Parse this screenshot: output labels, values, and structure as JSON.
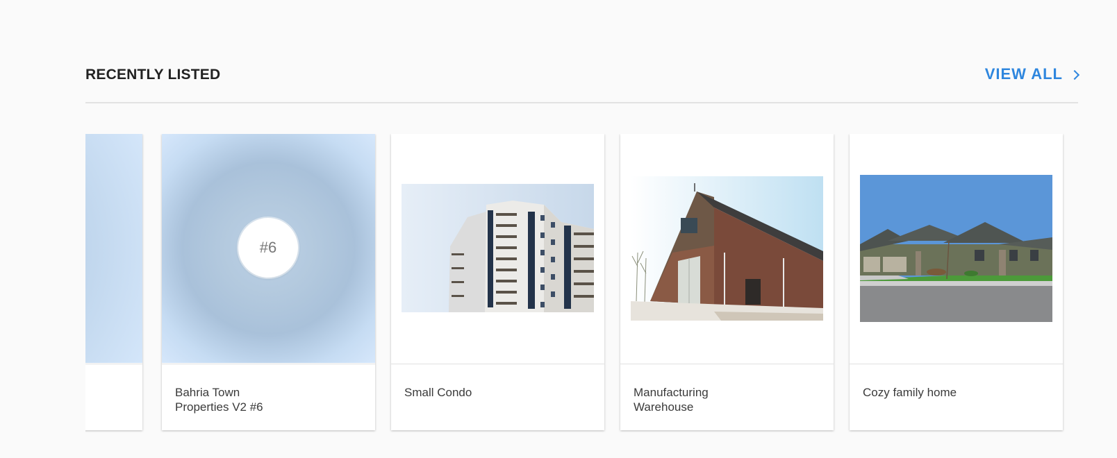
{
  "section": {
    "title": "RECENTLY LISTED",
    "view_all_label": "VIEW ALL"
  },
  "colors": {
    "accent": "#2e86de",
    "background": "#fafafa"
  },
  "listings": [
    {
      "title": ""
    },
    {
      "title": "Bahria Town Properties V2 #6",
      "title_line1": "Bahria Town",
      "title_line2": "Properties V2 #6",
      "badge": "#6"
    },
    {
      "title": "Small Condo"
    },
    {
      "title": "Manufacturing Warehouse",
      "title_line1": "Manufacturing",
      "title_line2": "Warehouse"
    },
    {
      "title": "Cozy family home"
    }
  ],
  "icons": {
    "view_all": "chevron-right-icon"
  }
}
